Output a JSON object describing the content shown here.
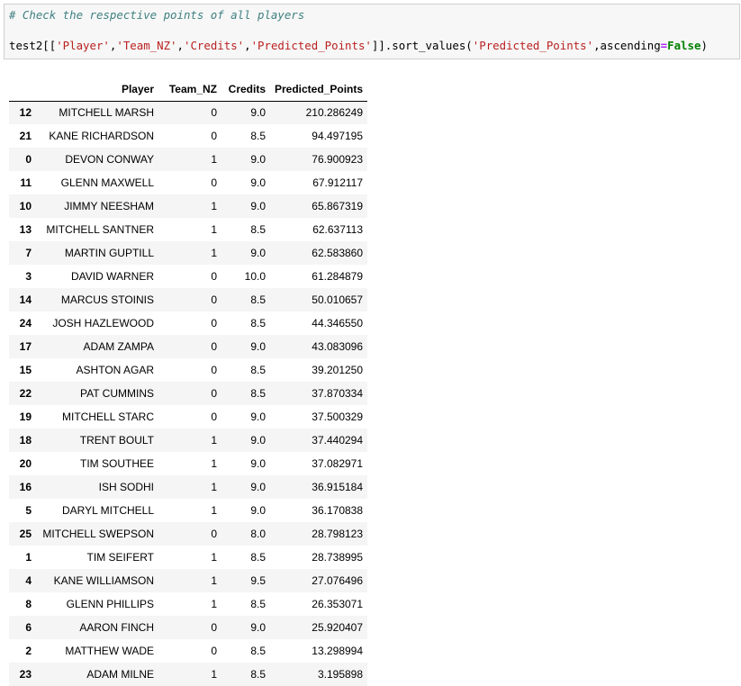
{
  "cell": {
    "comment": "# Check the respective points of all players",
    "code": {
      "prefix": "test2[[",
      "cols": [
        "'Player'",
        "'Team_NZ'",
        "'Credits'",
        "'Predicted_Points'"
      ],
      "middle": "]].sort_values(",
      "sort_col": "'Predicted_Points'",
      "kwarg": "ascending",
      "eq": "=",
      "kwval": "False",
      "suffix": ")"
    }
  },
  "table": {
    "headers": [
      "",
      "Player",
      "Team_NZ",
      "Credits",
      "Predicted_Points"
    ],
    "rows": [
      [
        "12",
        "MITCHELL MARSH",
        "0",
        "9.0",
        "210.286249"
      ],
      [
        "21",
        "KANE RICHARDSON",
        "0",
        "8.5",
        "94.497195"
      ],
      [
        "0",
        "DEVON CONWAY",
        "1",
        "9.0",
        "76.900923"
      ],
      [
        "11",
        "GLENN MAXWELL",
        "0",
        "9.0",
        "67.912117"
      ],
      [
        "10",
        "JIMMY NEESHAM",
        "1",
        "9.0",
        "65.867319"
      ],
      [
        "13",
        "MITCHELL SANTNER",
        "1",
        "8.5",
        "62.637113"
      ],
      [
        "7",
        "MARTIN GUPTILL",
        "1",
        "9.0",
        "62.583860"
      ],
      [
        "3",
        "DAVID WARNER",
        "0",
        "10.0",
        "61.284879"
      ],
      [
        "14",
        "MARCUS STOINIS",
        "0",
        "8.5",
        "50.010657"
      ],
      [
        "24",
        "JOSH HAZLEWOOD",
        "0",
        "8.5",
        "44.346550"
      ],
      [
        "17",
        "ADAM ZAMPA",
        "0",
        "9.0",
        "43.083096"
      ],
      [
        "15",
        "ASHTON AGAR",
        "0",
        "8.5",
        "39.201250"
      ],
      [
        "22",
        "PAT CUMMINS",
        "0",
        "8.5",
        "37.870334"
      ],
      [
        "19",
        "MITCHELL STARC",
        "0",
        "9.0",
        "37.500329"
      ],
      [
        "18",
        "TRENT BOULT",
        "1",
        "9.0",
        "37.440294"
      ],
      [
        "20",
        "TIM SOUTHEE",
        "1",
        "9.0",
        "37.082971"
      ],
      [
        "16",
        "ISH SODHI",
        "1",
        "9.0",
        "36.915184"
      ],
      [
        "5",
        "DARYL MITCHELL",
        "1",
        "9.0",
        "36.170838"
      ],
      [
        "25",
        "MITCHELL SWEPSON",
        "0",
        "8.0",
        "28.798123"
      ],
      [
        "1",
        "TIM SEIFERT",
        "1",
        "8.5",
        "28.738995"
      ],
      [
        "4",
        "KANE WILLIAMSON",
        "1",
        "9.5",
        "27.076496"
      ],
      [
        "8",
        "GLENN PHILLIPS",
        "1",
        "8.5",
        "26.353071"
      ],
      [
        "6",
        "AARON FINCH",
        "0",
        "9.0",
        "25.920407"
      ],
      [
        "2",
        "MATTHEW WADE",
        "0",
        "8.5",
        "13.298994"
      ],
      [
        "23",
        "ADAM MILNE",
        "1",
        "8.5",
        "3.195898"
      ]
    ]
  }
}
